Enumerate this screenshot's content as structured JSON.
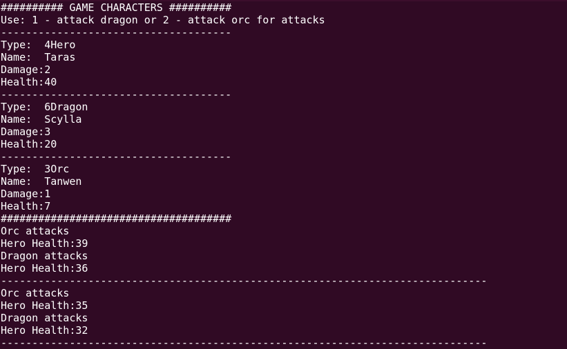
{
  "colors": {
    "background": "#300a24",
    "text": "#ffffff"
  },
  "terminal": {
    "lines": [
      "########## GAME CHARACTERS ##########",
      "Use: 1 - attack dragon or 2 - attack orc for attacks",
      "-------------------------------------",
      "Type:  4Hero",
      "Name:  Taras",
      "Damage:2",
      "Health:40",
      "-------------------------------------",
      "Type:  6Dragon",
      "Name:  Scylla",
      "Damage:3",
      "Health:20",
      "-------------------------------------",
      "Type:  3Orc",
      "Name:  Tanwen",
      "Damage:1",
      "Health:7",
      "#####################################",
      "Orc attacks",
      "Hero Health:39",
      "Dragon attacks",
      "Hero Health:36",
      "------------------------------------------------------------------------------",
      "Orc attacks",
      "Hero Health:35",
      "Dragon attacks",
      "Hero Health:32",
      "------------------------------------------------------------------------------"
    ]
  }
}
